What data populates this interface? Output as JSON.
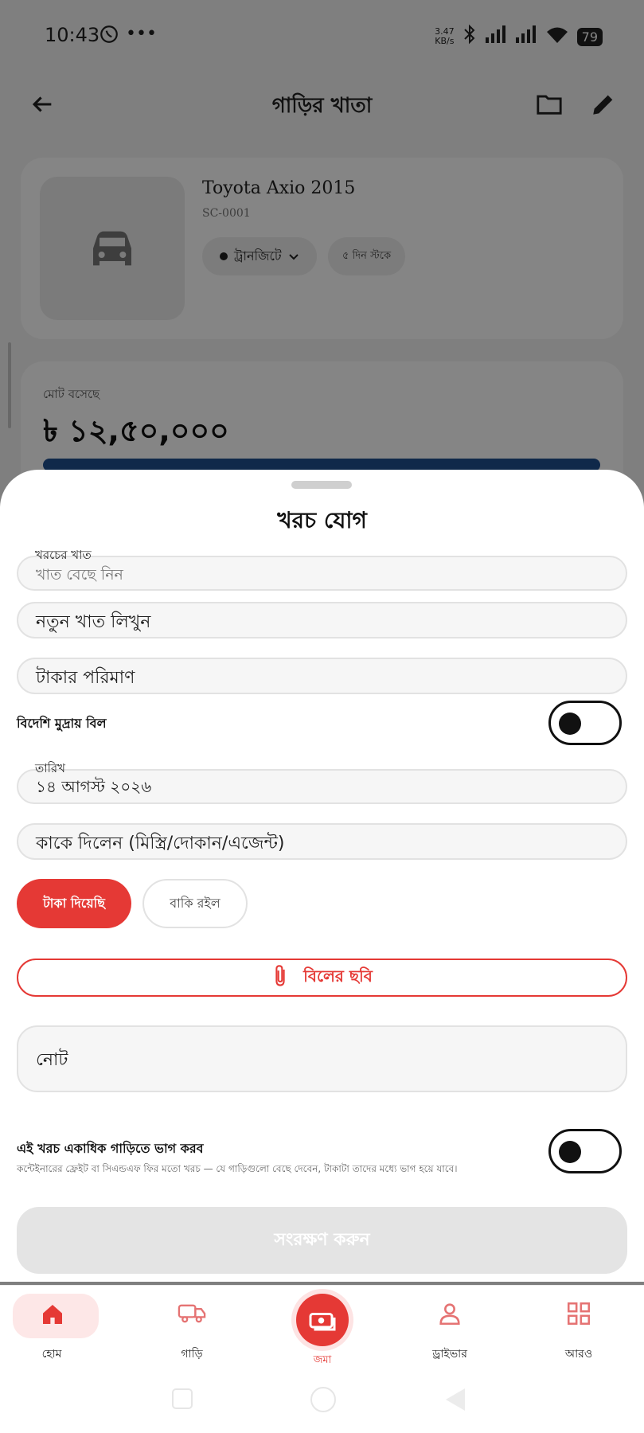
{
  "status_bar": {
    "time": "10:43",
    "speed_value": "3.47",
    "speed_unit": "KB/s",
    "battery": "79"
  },
  "app_bar": {
    "title": "গাড়ির খাতা"
  },
  "car": {
    "name": "Toyota Axio 2015",
    "code": "SC-0001",
    "status": "ট্রানজিটে",
    "days_in_stock": "৫ দিন স্টকে"
  },
  "investment": {
    "label": "মোট বসেছে",
    "amount": "৳ ১২,৫০,০০০",
    "progress": 1.0
  },
  "sheet": {
    "title": "খরচ যোগ",
    "category_label": "খরচের খাত",
    "category_placeholder": "খাত বেছে নিন",
    "new_category_placeholder": "নতুন খাত লিখুন",
    "amount_placeholder": "টাকার পরিমাণ",
    "foreign_currency_label": "বিদেশি মুদ্রায় বিল",
    "foreign_currency_on": false,
    "date_label": "তারিখ",
    "date_value": "১৪ আগস্ট ২০২৬",
    "payee_placeholder": "কাকে দিলেন (মিস্ত্রি/দোকান/এজেন্ট)",
    "paid_button": "টাকা দিয়েছি",
    "due_button": "বাকি রইল",
    "bill_photo_button": "বিলের ছবি",
    "note_placeholder": "নোট",
    "split_title": "এই খরচ একাধিক গাড়িতে ভাগ করব",
    "split_desc": "কন্টেইনারের ফ্রেইট বা সিএন্ডএফ ফির মতো খরচ — যে গাড়িগুলো বেছে দেবেন, টাকাটা তাদের মধ্যে ভাগ হয়ে যাবে।",
    "split_on": false,
    "save_button": "সংরক্ষণ করুন"
  },
  "bottom_nav": {
    "home": "হোম",
    "vehicles": "গাড়ি",
    "deposit": "জমা",
    "driver": "ড্রাইভার",
    "more": "আরও"
  },
  "colors": {
    "accent": "#e53935",
    "progress": "#1f4f8f"
  }
}
